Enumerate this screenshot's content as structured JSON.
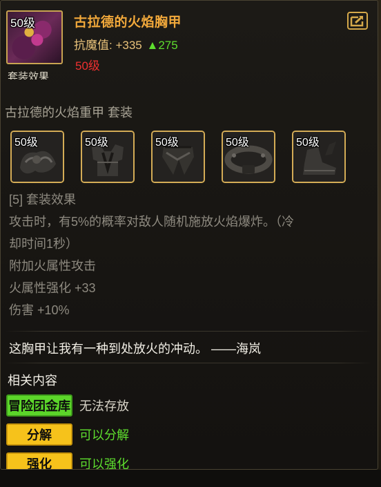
{
  "item": {
    "level": "50级",
    "name": "古拉德的火焰胸甲",
    "stat_label": "抗魔值:",
    "stat_value": "+335",
    "stat_bonus": "▲275",
    "required_level": "50级",
    "clipped_text": "套装效果",
    "icon": "flame-chest-armor-icon"
  },
  "header": {
    "compare_icon": "compare-arrow-icon"
  },
  "set": {
    "name": "古拉德的火焰重甲  套装",
    "pieces": [
      {
        "level": "50级",
        "icon": "shoulder-armor-icon"
      },
      {
        "level": "50级",
        "icon": "chest-armor-icon"
      },
      {
        "level": "50级",
        "icon": "pants-armor-icon"
      },
      {
        "level": "50级",
        "icon": "belt-armor-icon"
      },
      {
        "level": "50级",
        "icon": "boots-armor-icon"
      }
    ],
    "bonus_lines": [
      "[5] 套装效果",
      "攻击时，有5%的概率对敌人随机施放火焰爆炸。（冷",
      "却时间1秒）",
      "附加火属性攻击",
      "火属性强化 +33",
      "伤害 +10%"
    ]
  },
  "quote": "这胸甲让我有一种到处放火的冲动。 ——海岚",
  "related": {
    "title": "相关内容",
    "rows": [
      {
        "tag": "冒险团金库",
        "desc": "无法存放",
        "tag_color": "#5cd62a",
        "desc_color": "#d8d4c8"
      },
      {
        "tag": "分解",
        "desc": "可以分解",
        "tag_color": "#f6c21b",
        "desc_color": "#5ede2e"
      },
      {
        "tag": "强化",
        "desc": "可以强化",
        "tag_color": "#f6c21b",
        "desc_color": "#5ede2e"
      }
    ]
  }
}
